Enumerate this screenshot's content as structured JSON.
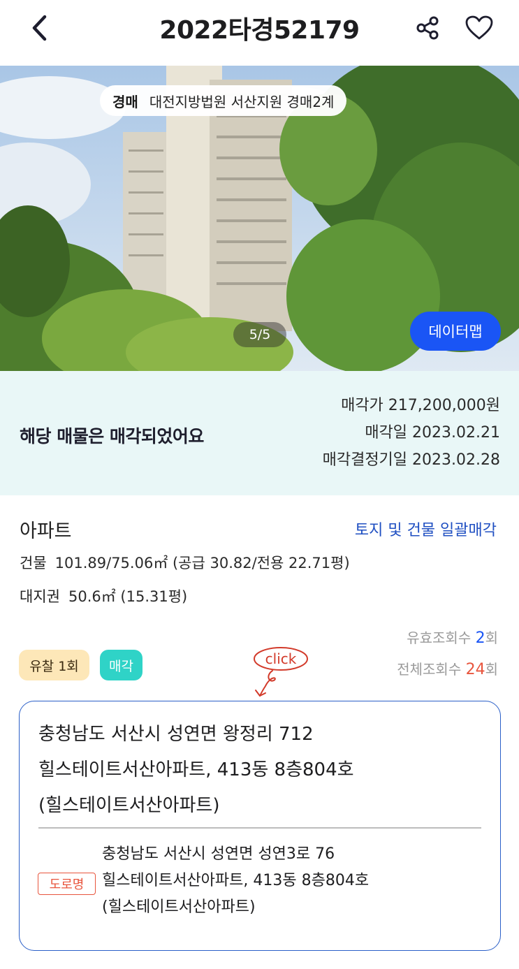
{
  "header": {
    "title": "2022타경52179",
    "back_icon": "chevron-left-icon",
    "share_icon": "share-icon",
    "favorite_icon": "heart-outline-icon"
  },
  "photo": {
    "auction_tag": "경매",
    "court": "대전지방법원 서산지원  경매2계",
    "counter": "5/5",
    "datamap_label": "데이터맵"
  },
  "sold_banner": {
    "message": "해당 매물은 매각되었어요",
    "price": "매각가 217,200,000원",
    "date": "매각일 2023.02.21",
    "decision_date": "매각결정기일 2023.02.28"
  },
  "property": {
    "type": "아파트",
    "bulk_sale_link": "토지 및 건물 일괄매각",
    "building_label": "건물",
    "building_value": "101.89/75.06㎡ (공급 30.82/전용 22.71평)",
    "land_label": "대지권",
    "land_value": "50.6㎡ (15.31평)"
  },
  "views": {
    "valid_label": "유효조회수",
    "valid_count": "2",
    "valid_unit": "회",
    "total_label": "전체조회수",
    "total_count": "24",
    "total_unit": "회"
  },
  "chips": {
    "failed": "유찰 1회",
    "sold": "매각"
  },
  "annotation": {
    "click_text": "click"
  },
  "address": {
    "line1": "충청남도 서산시 성연면 왕정리 712",
    "line2": "힐스테이트서산아파트, 413동 8층804호",
    "line3": "(힐스테이트서산아파트)",
    "road_tag": "도로명",
    "road_line1": "충청남도 서산시 성연면 성연3로 76",
    "road_line2": "힐스테이트서산아파트, 413동 8층804호",
    "road_line3": "(힐스테이트서산아파트)"
  },
  "colors": {
    "accent_blue": "#1a55f5",
    "sold_banner_bg": "#e9f7f7",
    "link_blue": "#1f4fc2",
    "road_tag_red": "#e8553d",
    "chip_fail_bg": "#fde7b8",
    "chip_sold_bg": "#2fd3c7"
  }
}
